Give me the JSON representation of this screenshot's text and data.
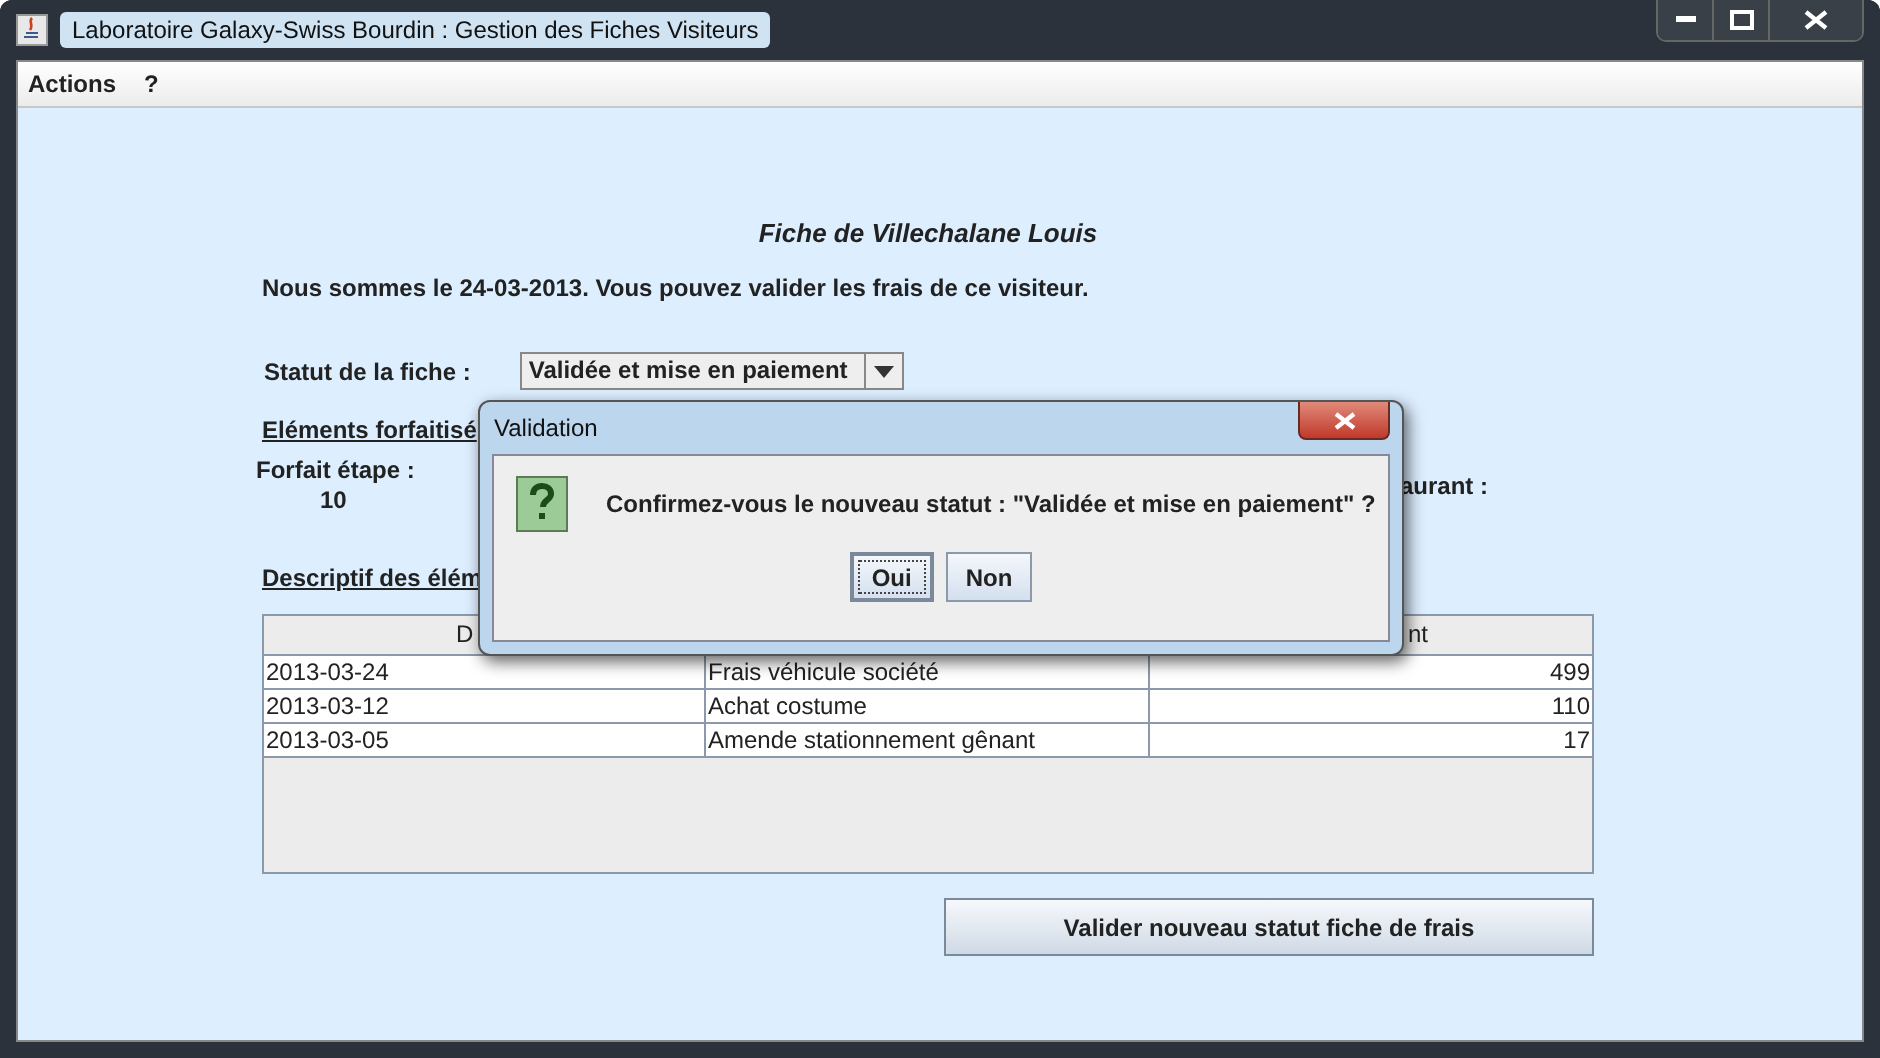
{
  "window": {
    "title": "Laboratoire Galaxy-Swiss Bourdin : Gestion des Fiches Visiteurs"
  },
  "menu": [
    "Actions",
    "?"
  ],
  "form": {
    "heading": "Fiche de Villechalane Louis",
    "intro": "Nous sommes le 24-03-2013. Vous pouvez valider les frais de ce visiteur.",
    "status_label": "Statut de la fiche :",
    "status_value": "Validée et mise en paiement",
    "section_1": "Eléments forfaitisé",
    "forfait_label": "Forfait étape :",
    "forfait_value": "10",
    "label_2": "aurant :",
    "section_2": "Descriptif des élém"
  },
  "table": {
    "columns": [
      "D",
      "",
      "nt"
    ],
    "rows": [
      [
        "2013-03-24",
        "Frais véhicule société",
        "499"
      ],
      [
        "2013-03-12",
        "Achat costume",
        "110"
      ],
      [
        "2013-03-05",
        "Amende stationnement gênant",
        "17"
      ]
    ]
  },
  "submit_button": "Valider nouveau statut fiche de frais",
  "dialog": {
    "title": "Validation",
    "message": "Confirmez-vous le nouveau statut : \"Validée et mise en paiement\" ?",
    "buttons": [
      {
        "label": "Oui",
        "selected": true
      },
      {
        "label": "Non",
        "selected": false
      }
    ]
  }
}
